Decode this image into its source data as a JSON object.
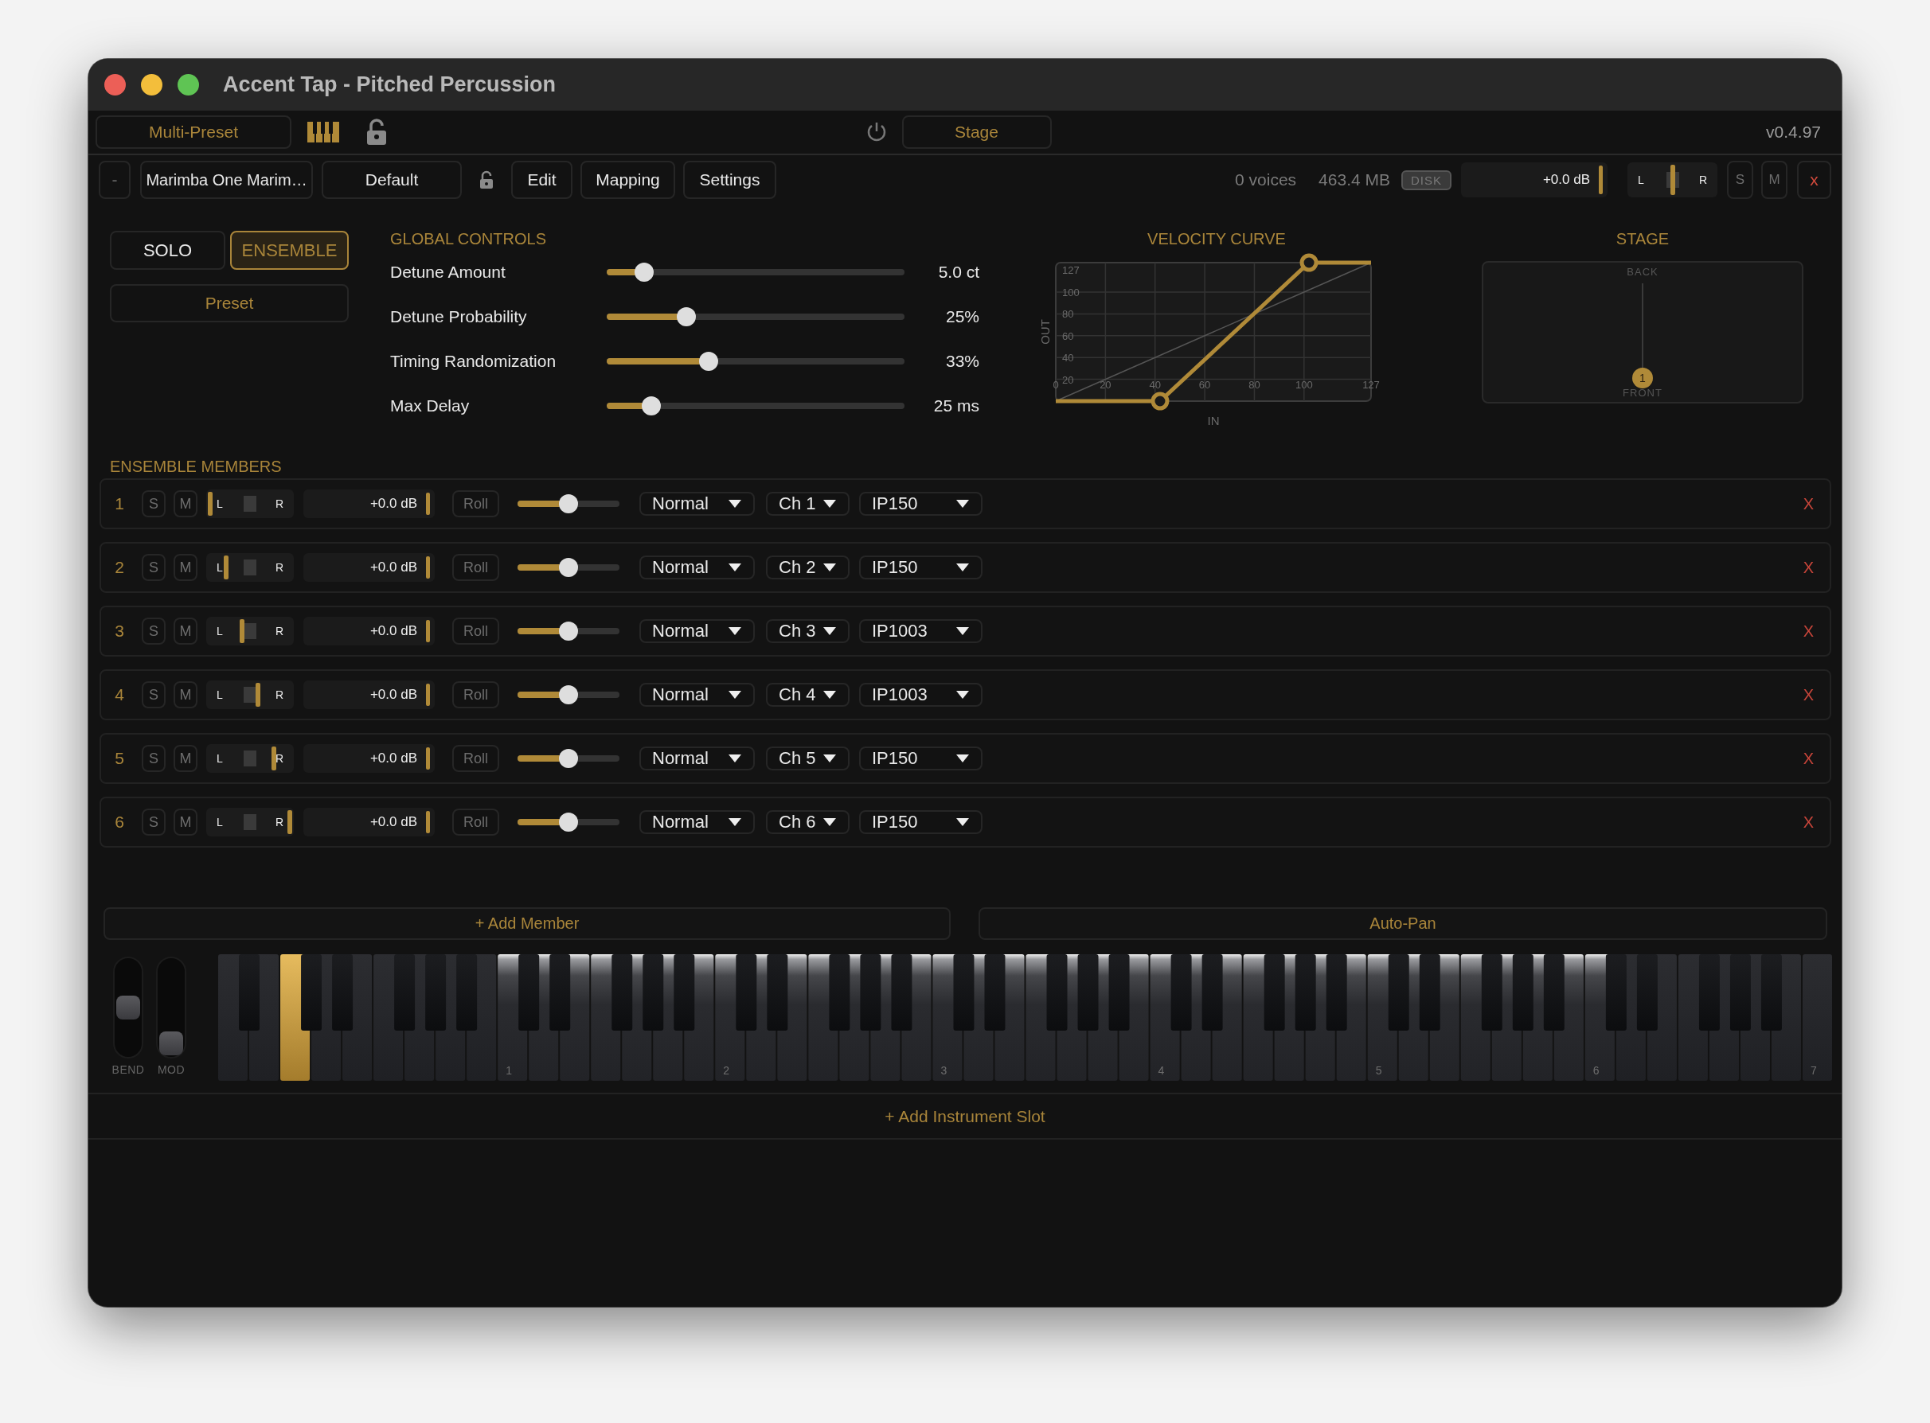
{
  "window": {
    "title": "Accent Tap - Pitched Percussion"
  },
  "header": {
    "preset_button": "Multi-Preset",
    "stage_button": "Stage",
    "version": "v0.4.97"
  },
  "instrument_bar": {
    "remove_button": "-",
    "instrument": "Marimba One Marim…",
    "preset": "Default",
    "buttons": [
      "Edit",
      "Mapping",
      "Settings"
    ],
    "voices": "0 voices",
    "memory": "463.4 MB",
    "disk_badge": "DISK",
    "volume": "+0.0 dB",
    "pan": {
      "left": "L",
      "right": "R",
      "level": 0.5
    },
    "solo": "S",
    "mute": "M",
    "close": "x"
  },
  "mode": {
    "options": [
      {
        "label": "SOLO",
        "selected": false
      },
      {
        "label": "ENSEMBLE",
        "selected": true
      }
    ],
    "preset_button": "Preset"
  },
  "global_controls": {
    "title": "GLOBAL CONTROLS",
    "sliders": [
      {
        "label": "Detune Amount",
        "level": 0.1,
        "reading": "5.0 ct"
      },
      {
        "label": "Detune Probability",
        "level": 0.25,
        "reading": "25%"
      },
      {
        "label": "Timing Randomization",
        "level": 0.33,
        "reading": "33%"
      },
      {
        "label": "Max Delay",
        "level": 0.125,
        "reading": "25 ms"
      }
    ]
  },
  "velocity_curve": {
    "chart_data": {
      "type": "line",
      "title": "VELOCITY CURVE",
      "xlabel": "IN",
      "ylabel": "OUT",
      "x": [
        0,
        42,
        102,
        127
      ],
      "series": [
        {
          "color": "#b08a38",
          "values": [
            0,
            0,
            127,
            127
          ]
        },
        {
          "color": "#555555",
          "values": [
            0,
            42,
            102,
            127
          ]
        }
      ],
      "grid": true,
      "xlim": [
        0,
        127
      ],
      "ylim": [
        0,
        127
      ],
      "xticks": [
        0,
        20,
        40,
        60,
        80,
        100,
        127
      ],
      "yticks": [
        20,
        40,
        60,
        80,
        100,
        127
      ]
    }
  },
  "stage": {
    "title": "STAGE",
    "back": "BACK",
    "front": "FRONT",
    "members": [
      {
        "label": "1"
      }
    ]
  },
  "ensemble": {
    "title": "ENSEMBLE MEMBERS",
    "members": [
      {
        "number": "1",
        "solo": "S",
        "mute": "M",
        "pan": {
          "left": "L",
          "right": "R",
          "level": 0
        },
        "volume": "+0.0 dB",
        "roll": "Roll",
        "level": 0.5,
        "articulation": "Normal",
        "channel": "Ch 1",
        "preset": "IP150",
        "remove": "X"
      },
      {
        "number": "2",
        "solo": "S",
        "mute": "M",
        "pan": {
          "left": "L",
          "right": "R",
          "level": 0.2
        },
        "volume": "+0.0 dB",
        "roll": "Roll",
        "level": 0.5,
        "articulation": "Normal",
        "channel": "Ch 2",
        "preset": "IP150",
        "remove": "X"
      },
      {
        "number": "3",
        "solo": "S",
        "mute": "M",
        "pan": {
          "left": "L",
          "right": "R",
          "level": 0.4
        },
        "volume": "+0.0 dB",
        "roll": "Roll",
        "level": 0.5,
        "articulation": "Normal",
        "channel": "Ch 3",
        "preset": "IP1003",
        "remove": "X"
      },
      {
        "number": "4",
        "solo": "S",
        "mute": "M",
        "pan": {
          "left": "L",
          "right": "R",
          "level": 0.6
        },
        "volume": "+0.0 dB",
        "roll": "Roll",
        "level": 0.5,
        "articulation": "Normal",
        "channel": "Ch 4",
        "preset": "IP1003",
        "remove": "X"
      },
      {
        "number": "5",
        "solo": "S",
        "mute": "M",
        "pan": {
          "left": "L",
          "right": "R",
          "level": 0.8
        },
        "volume": "+0.0 dB",
        "roll": "Roll",
        "level": 0.5,
        "articulation": "Normal",
        "channel": "Ch 5",
        "preset": "IP150",
        "remove": "X"
      },
      {
        "number": "6",
        "solo": "S",
        "mute": "M",
        "pan": {
          "left": "L",
          "right": "R",
          "level": 1
        },
        "volume": "+0.0 dB",
        "roll": "Roll",
        "level": 0.5,
        "articulation": "Normal",
        "channel": "Ch 6",
        "preset": "IP150",
        "remove": "X"
      }
    ]
  },
  "actions": {
    "add_member": "+ Add Member",
    "auto_pan": "Auto-Pan"
  },
  "keyboard": {
    "bend": {
      "label": "BEND",
      "level": 0.5
    },
    "mod": {
      "label": "MOD",
      "level": 0
    },
    "keys": [
      {
        "pressed": false,
        "in_range": false
      },
      {
        "pressed": false,
        "in_range": false
      },
      {
        "pressed": true,
        "in_range": false
      },
      {
        "pressed": false,
        "in_range": false
      },
      {
        "pressed": false,
        "in_range": false
      },
      {
        "pressed": false,
        "in_range": false
      },
      {
        "pressed": false,
        "in_range": false
      },
      {
        "pressed": false,
        "in_range": false
      },
      {
        "pressed": false,
        "in_range": false
      },
      {
        "pressed": false,
        "in_range": true,
        "label": "1"
      },
      {
        "pressed": false,
        "in_range": true
      },
      {
        "pressed": false,
        "in_range": true
      },
      {
        "pressed": false,
        "in_range": true
      },
      {
        "pressed": false,
        "in_range": true
      },
      {
        "pressed": false,
        "in_range": true
      },
      {
        "pressed": false,
        "in_range": true
      },
      {
        "pressed": false,
        "in_range": true,
        "label": "2"
      },
      {
        "pressed": false,
        "in_range": true
      },
      {
        "pressed": false,
        "in_range": true
      },
      {
        "pressed": false,
        "in_range": true
      },
      {
        "pressed": false,
        "in_range": true
      },
      {
        "pressed": false,
        "in_range": true
      },
      {
        "pressed": false,
        "in_range": true
      },
      {
        "pressed": false,
        "in_range": true,
        "label": "3"
      },
      {
        "pressed": false,
        "in_range": true
      },
      {
        "pressed": false,
        "in_range": true
      },
      {
        "pressed": false,
        "in_range": true
      },
      {
        "pressed": false,
        "in_range": true
      },
      {
        "pressed": false,
        "in_range": true
      },
      {
        "pressed": false,
        "in_range": true
      },
      {
        "pressed": false,
        "in_range": true,
        "label": "4"
      },
      {
        "pressed": false,
        "in_range": true
      },
      {
        "pressed": false,
        "in_range": true
      },
      {
        "pressed": false,
        "in_range": true
      },
      {
        "pressed": false,
        "in_range": true
      },
      {
        "pressed": false,
        "in_range": true
      },
      {
        "pressed": false,
        "in_range": true
      },
      {
        "pressed": false,
        "in_range": true,
        "label": "5"
      },
      {
        "pressed": false,
        "in_range": true
      },
      {
        "pressed": false,
        "in_range": true
      },
      {
        "pressed": false,
        "in_range": true
      },
      {
        "pressed": false,
        "in_range": true
      },
      {
        "pressed": false,
        "in_range": true
      },
      {
        "pressed": false,
        "in_range": true
      },
      {
        "pressed": false,
        "in_range": true,
        "label": "6"
      },
      {
        "pressed": false,
        "in_range": false
      },
      {
        "pressed": false,
        "in_range": false
      },
      {
        "pressed": false,
        "in_range": false
      },
      {
        "pressed": false,
        "in_range": false
      },
      {
        "pressed": false,
        "in_range": false
      },
      {
        "pressed": false,
        "in_range": false
      },
      {
        "pressed": false,
        "in_range": false,
        "label": "7"
      }
    ]
  },
  "add_slot": "+ Add Instrument Slot"
}
